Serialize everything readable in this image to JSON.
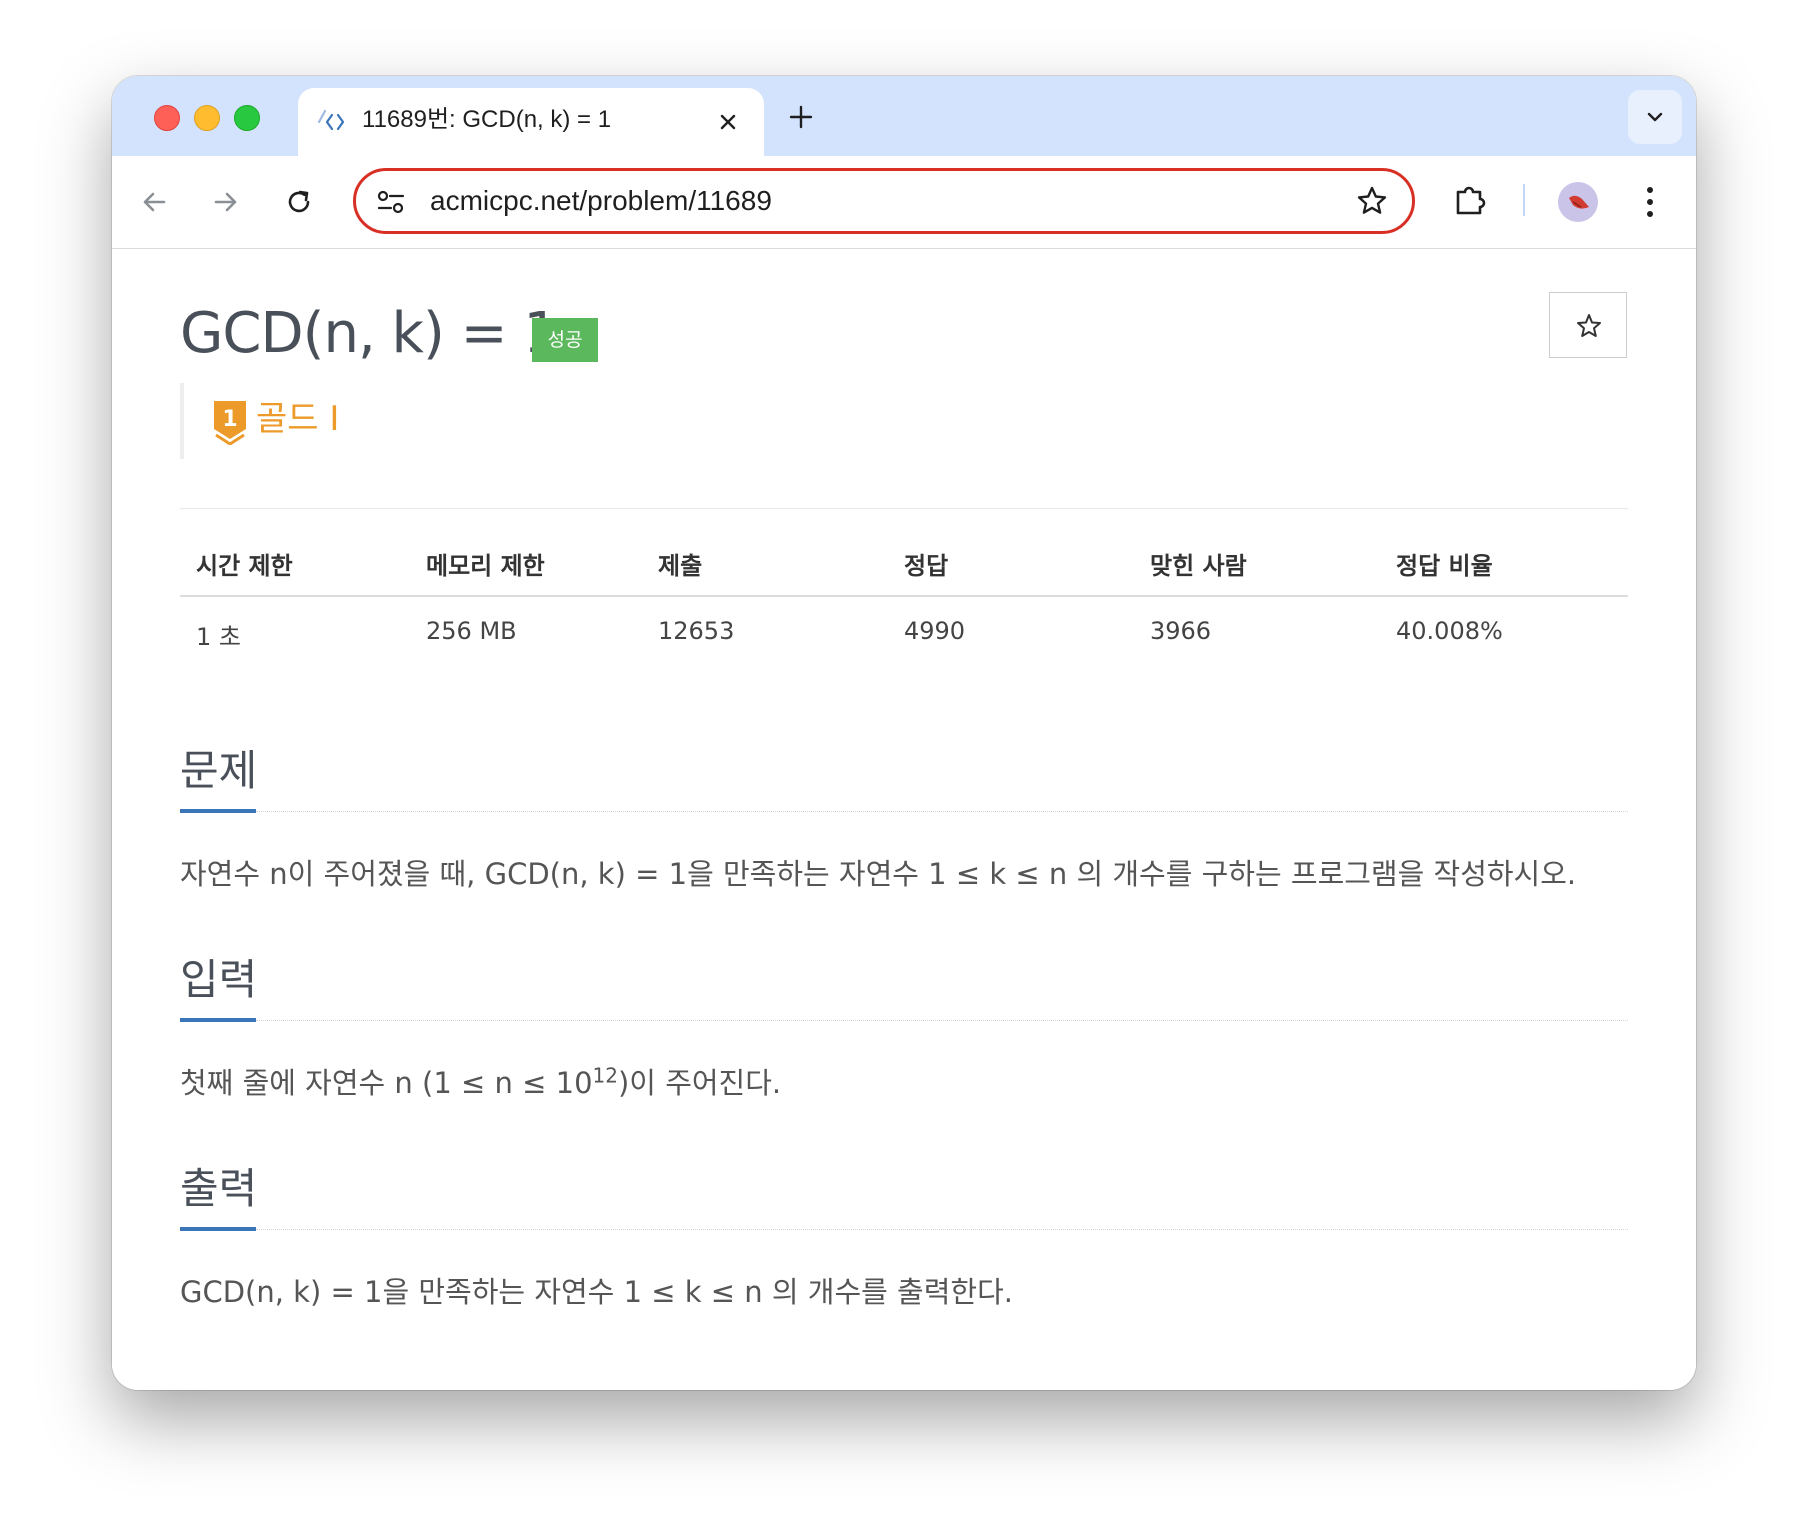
{
  "browser": {
    "tab_title": "11689번: GCD(n, k) = 1",
    "url": "acmicpc.net/problem/11689"
  },
  "problem": {
    "title": "GCD(n, k) = 1",
    "status_badge": "성공",
    "tier": "골드 I",
    "tier_number": "1",
    "tier_color": "#ec9a29"
  },
  "info_table": {
    "headers": [
      "시간 제한",
      "메모리 제한",
      "제출",
      "정답",
      "맞힌 사람",
      "정답 비율"
    ],
    "values": [
      "1 초",
      "256 MB",
      "12653",
      "4990",
      "3966",
      "40.008%"
    ]
  },
  "sections": {
    "problem": {
      "title": "문제",
      "text": "자연수 n이 주어졌을 때, GCD(n, k) = 1을 만족하는 자연수 1 ≤ k ≤ n 의 개수를 구하는 프로그램을 작성하시오."
    },
    "input": {
      "title": "입력",
      "text_before": "첫째 줄에 자연수 n (1 ≤ n ≤ 10",
      "exponent": "12",
      "text_after": ")이 주어진다."
    },
    "output": {
      "title": "출력",
      "text": "GCD(n, k) = 1을 만족하는 자연수 1 ≤ k ≤ n 의 개수를 출력한다."
    }
  },
  "colors": {
    "accent_blue": "#3b75b9",
    "success_green": "#5cb85c",
    "omnibox_border": "#d93025"
  }
}
